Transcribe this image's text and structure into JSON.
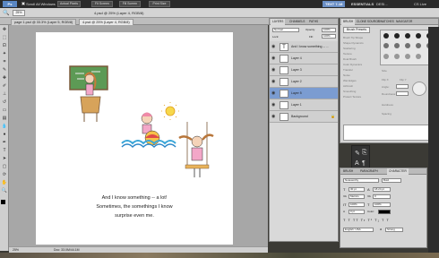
{
  "menubar": {
    "app_icon": "Ps",
    "scroll_all_label": "Scroll All Windows",
    "actual_pixels": "Actual Pixels",
    "fit_screen": "Fit Screen",
    "fill_screen": "Fill Screen",
    "print_size": "Print Size",
    "zoom": "25%",
    "workspace_tab": "TEXT 7-18",
    "essentials": "ESSENTIALS",
    "design": "DESI...",
    "cs_live": "CS Live"
  },
  "window_title": "4.psd @ 25% (Layer 4, RGB/8)",
  "tabs": [
    {
      "label": "page 1.psd @ 33.3% (Layer 5, RGB/8)"
    },
    {
      "label": "4.psd @ 25% (Layer 4, RGB/8)"
    }
  ],
  "document": {
    "caption_line1": "And I know something -- a lot!",
    "caption_line2": "Sometimes, the somethings I know",
    "caption_line3": "surprise even me."
  },
  "status": {
    "zoom": "25%",
    "doc_size": "Doc: 33.0M/44.1M"
  },
  "layers_panel": {
    "tabs": [
      "LAYERS",
      "CHANNELS",
      "PATHS"
    ],
    "blend_mode": "Normal",
    "opacity_label": "Opacity:",
    "opacity_value": "100%",
    "lock_label": "Lock:",
    "fill_label": "Fill:",
    "fill_value": "100%",
    "layers": [
      {
        "name": "And I know something -- ..."
      },
      {
        "name": "Layer 4"
      },
      {
        "name": "Layer 3"
      },
      {
        "name": "Layer 2"
      },
      {
        "name": "Layer 5"
      },
      {
        "name": "Layer 1"
      },
      {
        "name": "Background"
      }
    ]
  },
  "brush_panel": {
    "tabs": [
      "BRUSH",
      "CLONE SOURCE",
      "SWATCHES",
      "NAVIGATOR"
    ],
    "brush_presets_btn": "Brush Presets",
    "options": [
      "Brush Tip Shape",
      "Shape Dynamics",
      "Scattering",
      "Texture",
      "Dual Brush",
      "Color Dynamics",
      "Transfer",
      "Noise",
      "Wet Edges",
      "Airbrush",
      "Smoothing",
      "Protect Texture"
    ],
    "size_label": "Size",
    "flip_x": "Flip X",
    "flip_y": "Flip Y",
    "angle_label": "Angle:",
    "roundness_label": "Roundness:",
    "hardness_label": "Hardness",
    "spacing_label": "Spacing"
  },
  "char_panel": {
    "tabs": [
      "BRUSH",
      "PARAGRAPH",
      "CHARACTER"
    ],
    "font_family": "Noteworthy",
    "font_style": "Bold",
    "size": "30 pt",
    "leading": "18.24 pt",
    "kerning": "Metrics",
    "tracking": "0",
    "vertical_scale": "100%",
    "horizontal_scale": "100%",
    "baseline": "0 pt",
    "color_label": "Color:",
    "language": "English: USA",
    "aa_label": "a",
    "aa_value": "Strong"
  },
  "colors": {
    "selected_layer": "#7b9cd1",
    "workspace_tab": "#6a8fc6"
  }
}
